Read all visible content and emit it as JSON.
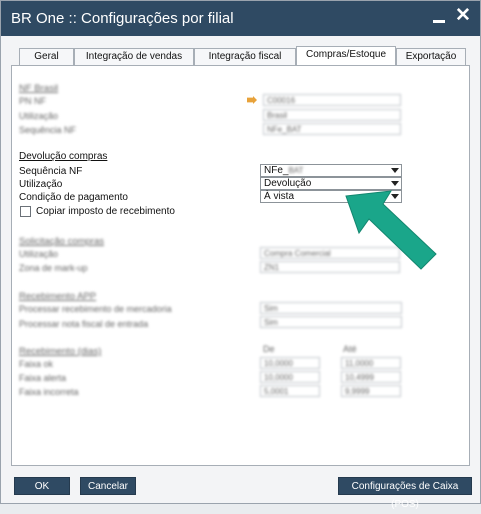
{
  "window": {
    "title": "BR One :: Configurações por filial"
  },
  "tabs": [
    {
      "label": "Geral",
      "active": false
    },
    {
      "label": "Integração de vendas",
      "active": false
    },
    {
      "label": "Integração fiscal",
      "active": false
    },
    {
      "label": "Compras/Estoque",
      "active": true
    },
    {
      "label": "Exportação",
      "active": false
    }
  ],
  "devolucao": {
    "header": "Devolução compras",
    "sequencia_label": "Sequência NF",
    "sequencia_value": "NFe_",
    "utilizacao_label": "Utilização",
    "utilizacao_value": "Devolução",
    "condicao_label": "Condição de pagamento",
    "condicao_value": "À vista",
    "copiar_label": "Copiar imposto de recebimento",
    "copiar_checked": false
  },
  "blurred": {
    "nf_header": "NF Brasil",
    "rows1": [
      "PN NF",
      "Utilização",
      "Sequência NF"
    ],
    "rows1_values": [
      "C00016",
      "Brasil",
      "NFe_BAT"
    ],
    "solicitacao_header": "Solicitação compras",
    "rows2": [
      "Utilização",
      "Zona de mark-up"
    ],
    "rows2_values": [
      "Compra Comercial",
      "ZN1"
    ],
    "recebimento_header": "Recebimento APP",
    "rows3": [
      "Processar recebimento de mercadoria",
      "Processar nota fiscal de entrada"
    ],
    "rows3_values": [
      "Sim",
      "Sim"
    ],
    "recebimento_dias_header": "Recebimento (dias)",
    "col_de": "De",
    "col_ate": "Até",
    "rows4": [
      "Faixa ok",
      "Faixa alerta",
      "Faixa incorreta"
    ],
    "rows4_de": [
      "10,0000",
      "10,0000",
      "5,0001"
    ],
    "rows4_ate": [
      "11,0000",
      "10,4999",
      "9,9999"
    ]
  },
  "buttons": {
    "ok": "OK",
    "cancelar": "Cancelar",
    "config_caixa": "Configurações de Caixa (POS)"
  },
  "colors": {
    "titlebar": "#2f4a63",
    "accent_arrow": "#1aa68a",
    "button": "#2f4a63"
  }
}
